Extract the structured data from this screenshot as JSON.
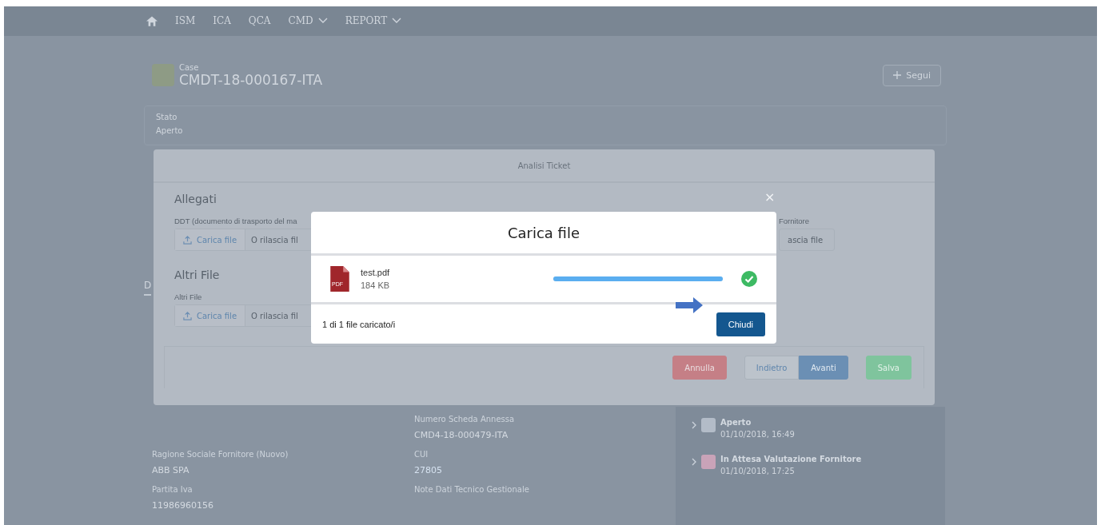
{
  "nav": {
    "items": [
      {
        "label": "ISM",
        "has_menu": false
      },
      {
        "label": "ICA",
        "has_menu": false
      },
      {
        "label": "QCA",
        "has_menu": false
      },
      {
        "label": "CMD",
        "has_menu": true
      },
      {
        "label": "REPORT",
        "has_menu": true
      }
    ]
  },
  "record": {
    "type_label": "Case",
    "title": "CMDT-18-000167-ITA",
    "follow_button": "Segui",
    "status_label": "Stato",
    "status_value": "Aperto",
    "tab_fragment": "D"
  },
  "details": {
    "fields": [
      {
        "label": "Numero Scheda Annessa",
        "value": "CMD4-18-000479-ITA"
      },
      {
        "label": "Ragione Sociale Fornitore (Nuovo)",
        "value": "ABB SPA"
      },
      {
        "label": "CUI",
        "value": "27805"
      },
      {
        "label": "Partita Iva",
        "value": "11986960156"
      },
      {
        "label": "Note Dati Tecnico Gestionale"
      }
    ]
  },
  "timeline": [
    {
      "title": "Aperto",
      "time": "01/10/2018, 16:49",
      "color": "#b3bcc8"
    },
    {
      "title": "In Attesa Valutazione Fornitore",
      "time": "01/10/2018, 17:25",
      "color": "#c9a3b8"
    }
  ],
  "modal": {
    "title": "Analisi Ticket",
    "close": "×",
    "sections": [
      {
        "heading": "Allegati",
        "uploads": [
          {
            "label": "DDT (documento di trasporto del ma",
            "button": "Carica file",
            "drop_text": "O rilascia fil"
          }
        ],
        "right_label": "Fornitore",
        "right_drop_text": "ascia file"
      },
      {
        "heading": "Altri File",
        "uploads": [
          {
            "label": "Altri File",
            "button": "Carica file",
            "drop_text": "O rilascia fil"
          }
        ]
      }
    ],
    "buttons": [
      {
        "label": "Annulla",
        "kind": "danger"
      },
      {
        "label": "Indietro",
        "kind": "neutral"
      },
      {
        "label": "Avanti",
        "kind": "brand"
      },
      {
        "label": "Salva",
        "kind": "success"
      }
    ]
  },
  "upload_dialog": {
    "title": "Carica file",
    "files": [
      {
        "name": "test.pdf",
        "size": "184 KB",
        "type_badge": "PDF",
        "level": 1,
        "done": true
      }
    ],
    "summary": "1 di 1 file caricato/i",
    "close_button": "Chiudi"
  }
}
